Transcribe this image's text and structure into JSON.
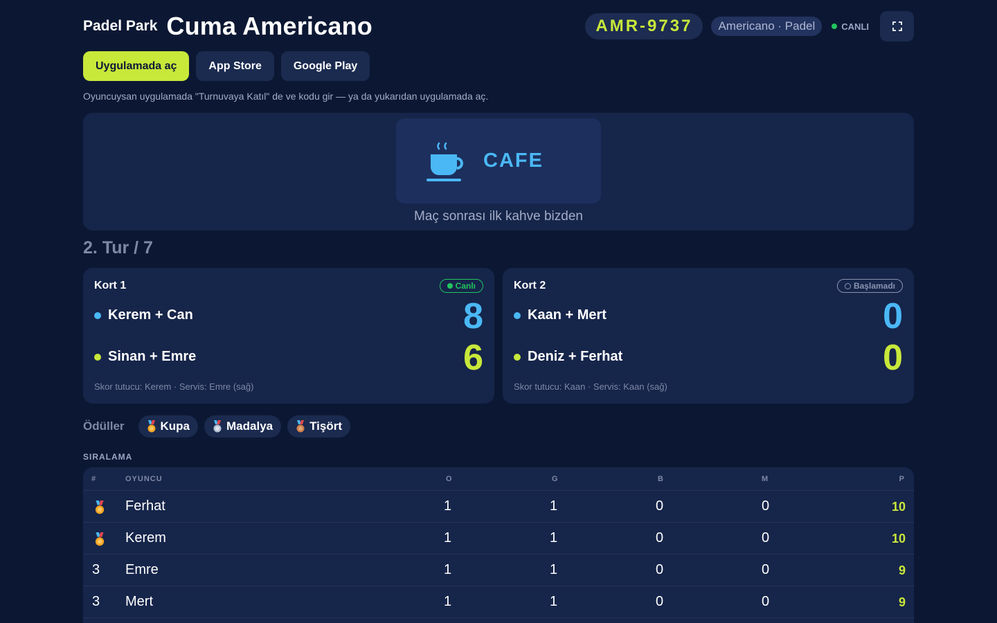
{
  "header": {
    "venue": "Padel Park",
    "title": "Cuma Americano",
    "code": "AMR-9737",
    "mode": "Americano · Padel",
    "live": "CANLI",
    "fullscreen_icon": "fullscreen-icon"
  },
  "buttons": {
    "open_app": "Uygulamada aç",
    "app_store": "App Store",
    "google_play": "Google Play"
  },
  "hint": "Oyuncuysan uygulamada \"Turnuvaya Katıl\" de ve kodu gir — ya da yukarıdan uygulamada aç.",
  "sponsor": {
    "icon": "coffee-cup-icon",
    "name": "CAFE",
    "caption": "Maç sonrası ilk kahve bizden"
  },
  "round": "2. Tur / 7",
  "courts": [
    {
      "name": "Kort 1",
      "status": "Canlı",
      "team_a": "Kerem + Can",
      "team_b": "Sinan + Emre",
      "score_a": "8",
      "score_b": "6",
      "footer": "Skor tutucu: Kerem · Servis: Emre (sağ)"
    },
    {
      "name": "Kort 2",
      "status": "Başlamadı",
      "team_a": "Kaan + Mert",
      "team_b": "Deniz + Ferhat",
      "score_a": "0",
      "score_b": "0",
      "footer": "Skor tutucu: Kaan · Servis: Kaan (sağ)"
    }
  ],
  "awards": {
    "label": "Ödüller",
    "items": [
      "Kupa",
      "Madalya",
      "Tişört"
    ]
  },
  "standings": {
    "title": "SIRALAMA",
    "headers": {
      "rank": "#",
      "player": "OYUNCU",
      "o": "O",
      "g": "G",
      "b": "B",
      "m": "M",
      "p": "P"
    },
    "rows": [
      {
        "rank": "",
        "medal": "gold-medal-icon",
        "player": "Ferhat",
        "o": "1",
        "g": "1",
        "b": "0",
        "m": "0",
        "p": "10"
      },
      {
        "rank": "",
        "medal": "gold-medal-icon",
        "player": "Kerem",
        "o": "1",
        "g": "1",
        "b": "0",
        "m": "0",
        "p": "10"
      },
      {
        "rank": "3",
        "player": "Emre",
        "o": "1",
        "g": "1",
        "b": "0",
        "m": "0",
        "p": "9"
      },
      {
        "rank": "3",
        "player": "Mert",
        "o": "1",
        "g": "1",
        "b": "0",
        "m": "0",
        "p": "9"
      }
    ]
  },
  "colors": {
    "background": "#0c1833",
    "card": "#16254a",
    "accent_lime": "#c8e83a",
    "accent_blue": "#4ab8f5",
    "live_green": "#22c55e"
  }
}
